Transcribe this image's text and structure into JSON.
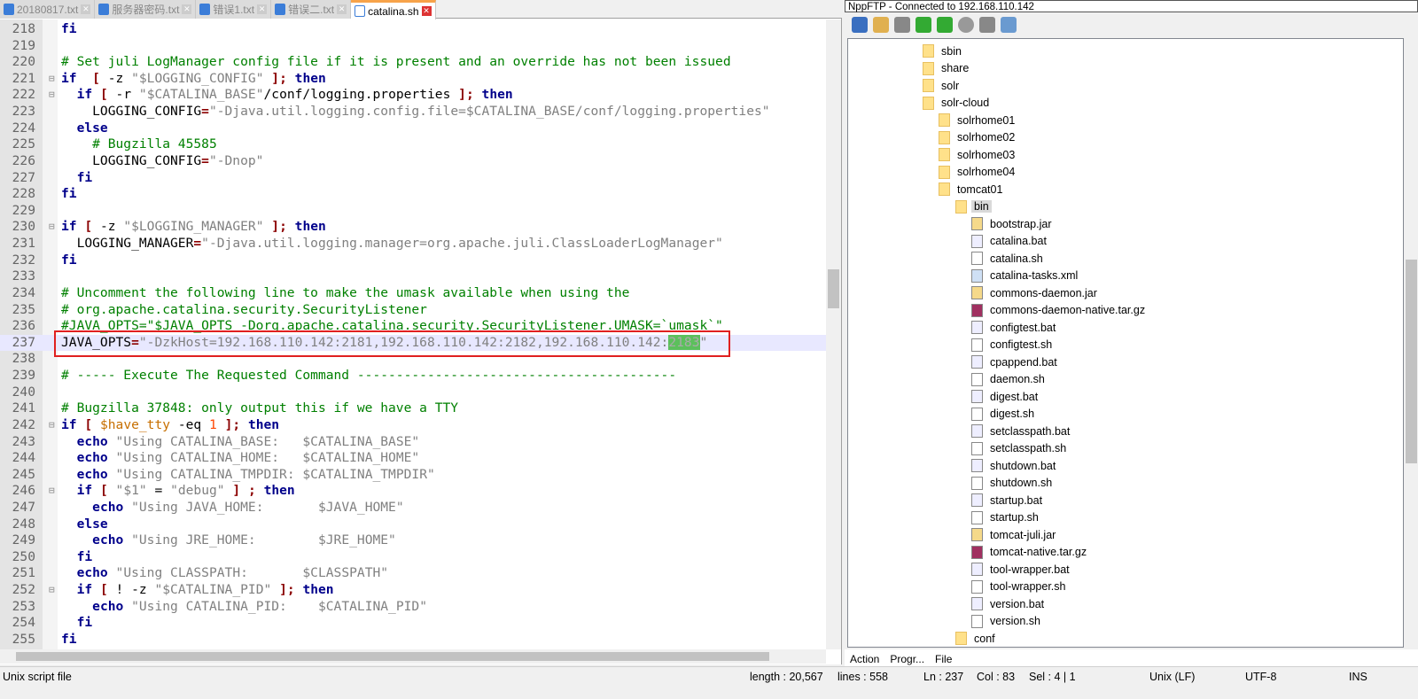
{
  "tabs": [
    {
      "label": "20180817.txt",
      "active": false
    },
    {
      "label": "服务器密码.txt",
      "active": false
    },
    {
      "label": "错误1.txt",
      "active": false
    },
    {
      "label": "错误二.txt",
      "active": false
    },
    {
      "label": "catalina.sh",
      "active": true
    }
  ],
  "editor": {
    "current_line": 237,
    "lines": [
      {
        "n": 218,
        "t": [
          [
            "kw",
            "fi"
          ]
        ]
      },
      {
        "n": 219,
        "t": []
      },
      {
        "n": 220,
        "t": [
          [
            "cm",
            "# Set juli LogManager config file if it is present and an override has not been issued"
          ]
        ]
      },
      {
        "n": 221,
        "t": [
          [
            "kw",
            "if"
          ],
          [
            "",
            "  "
          ],
          [
            "op",
            "["
          ],
          [
            "",
            " -z "
          ],
          [
            "str",
            "\"$LOGGING_CONFIG\""
          ],
          [
            "",
            " "
          ],
          [
            "op",
            "];"
          ],
          [
            "",
            " "
          ],
          [
            "kw",
            "then"
          ]
        ]
      },
      {
        "n": 222,
        "t": [
          [
            "",
            "  "
          ],
          [
            "kw",
            "if"
          ],
          [
            "",
            " "
          ],
          [
            "op",
            "["
          ],
          [
            "",
            " -r "
          ],
          [
            "str",
            "\"$CATALINA_BASE\""
          ],
          [
            "",
            "/conf/logging.properties "
          ],
          [
            "op",
            "];"
          ],
          [
            "",
            " "
          ],
          [
            "kw",
            "then"
          ]
        ]
      },
      {
        "n": 223,
        "t": [
          [
            "",
            "    LOGGING_CONFIG"
          ],
          [
            "op",
            "="
          ],
          [
            "str",
            "\"-Djava.util.logging.config.file=$CATALINA_BASE/conf/logging.properties\""
          ]
        ]
      },
      {
        "n": 224,
        "t": [
          [
            "",
            "  "
          ],
          [
            "kw",
            "else"
          ]
        ]
      },
      {
        "n": 225,
        "t": [
          [
            "",
            "    "
          ],
          [
            "cm",
            "# Bugzilla 45585"
          ]
        ]
      },
      {
        "n": 226,
        "t": [
          [
            "",
            "    LOGGING_CONFIG"
          ],
          [
            "op",
            "="
          ],
          [
            "str",
            "\"-Dnop\""
          ]
        ]
      },
      {
        "n": 227,
        "t": [
          [
            "",
            "  "
          ],
          [
            "kw",
            "fi"
          ]
        ]
      },
      {
        "n": 228,
        "t": [
          [
            "kw",
            "fi"
          ]
        ]
      },
      {
        "n": 229,
        "t": []
      },
      {
        "n": 230,
        "t": [
          [
            "kw",
            "if"
          ],
          [
            "",
            " "
          ],
          [
            "op",
            "["
          ],
          [
            "",
            " -z "
          ],
          [
            "str",
            "\"$LOGGING_MANAGER\""
          ],
          [
            "",
            " "
          ],
          [
            "op",
            "];"
          ],
          [
            "",
            " "
          ],
          [
            "kw",
            "then"
          ]
        ]
      },
      {
        "n": 231,
        "t": [
          [
            "",
            "  LOGGING_MANAGER"
          ],
          [
            "op",
            "="
          ],
          [
            "str",
            "\"-Djava.util.logging.manager=org.apache.juli.ClassLoaderLogManager\""
          ]
        ]
      },
      {
        "n": 232,
        "t": [
          [
            "kw",
            "fi"
          ]
        ]
      },
      {
        "n": 233,
        "t": []
      },
      {
        "n": 234,
        "t": [
          [
            "cm",
            "# Uncomment the following line to make the umask available when using the"
          ]
        ]
      },
      {
        "n": 235,
        "t": [
          [
            "cm",
            "# org.apache.catalina.security.SecurityListener"
          ]
        ]
      },
      {
        "n": 236,
        "t": [
          [
            "cm",
            "#JAVA_OPTS=\"$JAVA_OPTS -Dorg.apache.catalina.security.SecurityListener.UMASK=`umask`\""
          ]
        ]
      },
      {
        "n": 237,
        "t": [
          [
            "",
            "JAVA_OPTS"
          ],
          [
            "op",
            "="
          ],
          [
            "str",
            "\"-DzkHost=192.168.110.142:2181,192.168.110.142:2182,192.168.110.142:"
          ],
          [
            "sel",
            "2183"
          ],
          [
            "str",
            "\""
          ]
        ]
      },
      {
        "n": 238,
        "t": []
      },
      {
        "n": 239,
        "t": [
          [
            "cm",
            "# ----- Execute The Requested Command -----------------------------------------"
          ]
        ]
      },
      {
        "n": 240,
        "t": []
      },
      {
        "n": 241,
        "t": [
          [
            "cm",
            "# Bugzilla 37848: only output this if we have a TTY"
          ]
        ]
      },
      {
        "n": 242,
        "t": [
          [
            "kw",
            "if"
          ],
          [
            "",
            " "
          ],
          [
            "op",
            "["
          ],
          [
            "",
            " "
          ],
          [
            "var",
            "$have_tty"
          ],
          [
            "",
            " -eq "
          ],
          [
            "num",
            "1"
          ],
          [
            "",
            " "
          ],
          [
            "op",
            "];"
          ],
          [
            "",
            " "
          ],
          [
            "kw",
            "then"
          ]
        ]
      },
      {
        "n": 243,
        "t": [
          [
            "",
            "  "
          ],
          [
            "kw",
            "echo"
          ],
          [
            "",
            " "
          ],
          [
            "str",
            "\"Using CATALINA_BASE:   $CATALINA_BASE\""
          ]
        ]
      },
      {
        "n": 244,
        "t": [
          [
            "",
            "  "
          ],
          [
            "kw",
            "echo"
          ],
          [
            "",
            " "
          ],
          [
            "str",
            "\"Using CATALINA_HOME:   $CATALINA_HOME\""
          ]
        ]
      },
      {
        "n": 245,
        "t": [
          [
            "",
            "  "
          ],
          [
            "kw",
            "echo"
          ],
          [
            "",
            " "
          ],
          [
            "str",
            "\"Using CATALINA_TMPDIR: $CATALINA_TMPDIR\""
          ]
        ]
      },
      {
        "n": 246,
        "t": [
          [
            "",
            "  "
          ],
          [
            "kw",
            "if"
          ],
          [
            "",
            " "
          ],
          [
            "op",
            "["
          ],
          [
            "",
            " "
          ],
          [
            "str",
            "\"$1\""
          ],
          [
            "",
            " = "
          ],
          [
            "str",
            "\"debug\""
          ],
          [
            "",
            " "
          ],
          [
            "op",
            "]"
          ],
          [
            "",
            " "
          ],
          [
            "op",
            ";"
          ],
          [
            "",
            " "
          ],
          [
            "kw",
            "then"
          ]
        ]
      },
      {
        "n": 247,
        "t": [
          [
            "",
            "    "
          ],
          [
            "kw",
            "echo"
          ],
          [
            "",
            " "
          ],
          [
            "str",
            "\"Using JAVA_HOME:       $JAVA_HOME\""
          ]
        ]
      },
      {
        "n": 248,
        "t": [
          [
            "",
            "  "
          ],
          [
            "kw",
            "else"
          ]
        ]
      },
      {
        "n": 249,
        "t": [
          [
            "",
            "    "
          ],
          [
            "kw",
            "echo"
          ],
          [
            "",
            " "
          ],
          [
            "str",
            "\"Using JRE_HOME:        $JRE_HOME\""
          ]
        ]
      },
      {
        "n": 250,
        "t": [
          [
            "",
            "  "
          ],
          [
            "kw",
            "fi"
          ]
        ]
      },
      {
        "n": 251,
        "t": [
          [
            "",
            "  "
          ],
          [
            "kw",
            "echo"
          ],
          [
            "",
            " "
          ],
          [
            "str",
            "\"Using CLASSPATH:       $CLASSPATH\""
          ]
        ]
      },
      {
        "n": 252,
        "t": [
          [
            "",
            "  "
          ],
          [
            "kw",
            "if"
          ],
          [
            "",
            " "
          ],
          [
            "op",
            "["
          ],
          [
            "",
            " ! -z "
          ],
          [
            "str",
            "\"$CATALINA_PID\""
          ],
          [
            "",
            " "
          ],
          [
            "op",
            "];"
          ],
          [
            "",
            " "
          ],
          [
            "kw",
            "then"
          ]
        ]
      },
      {
        "n": 253,
        "t": [
          [
            "",
            "    "
          ],
          [
            "kw",
            "echo"
          ],
          [
            "",
            " "
          ],
          [
            "str",
            "\"Using CATALINA_PID:    $CATALINA_PID\""
          ]
        ]
      },
      {
        "n": 254,
        "t": [
          [
            "",
            "  "
          ],
          [
            "kw",
            "fi"
          ]
        ]
      },
      {
        "n": 255,
        "t": [
          [
            "kw",
            "fi"
          ]
        ]
      }
    ]
  },
  "ftp": {
    "title": "NppFTP - Connected to 192.168.110.142",
    "toolbar": [
      "connect-icon",
      "open-folder-icon",
      "download-icon",
      "upload-icon",
      "refresh-icon",
      "abort-icon",
      "settings-icon",
      "message-window-icon"
    ],
    "tree": [
      {
        "label": "sbin",
        "level": 0,
        "type": "folder"
      },
      {
        "label": "share",
        "level": 0,
        "type": "folder"
      },
      {
        "label": "solr",
        "level": 0,
        "type": "folder"
      },
      {
        "label": "solr-cloud",
        "level": 0,
        "type": "folder"
      },
      {
        "label": "solrhome01",
        "level": 1,
        "type": "folder"
      },
      {
        "label": "solrhome02",
        "level": 1,
        "type": "folder"
      },
      {
        "label": "solrhome03",
        "level": 1,
        "type": "folder"
      },
      {
        "label": "solrhome04",
        "level": 1,
        "type": "folder"
      },
      {
        "label": "tomcat01",
        "level": 1,
        "type": "folder"
      },
      {
        "label": "bin",
        "level": 2,
        "type": "folder",
        "selected": true
      },
      {
        "label": "bootstrap.jar",
        "level": 3,
        "type": "jar"
      },
      {
        "label": "catalina.bat",
        "level": 3,
        "type": "bat"
      },
      {
        "label": "catalina.sh",
        "level": 3,
        "type": "file"
      },
      {
        "label": "catalina-tasks.xml",
        "level": 3,
        "type": "xml"
      },
      {
        "label": "commons-daemon.jar",
        "level": 3,
        "type": "jar"
      },
      {
        "label": "commons-daemon-native.tar.gz",
        "level": 3,
        "type": "gz"
      },
      {
        "label": "configtest.bat",
        "level": 3,
        "type": "bat"
      },
      {
        "label": "configtest.sh",
        "level": 3,
        "type": "file"
      },
      {
        "label": "cpappend.bat",
        "level": 3,
        "type": "bat"
      },
      {
        "label": "daemon.sh",
        "level": 3,
        "type": "file"
      },
      {
        "label": "digest.bat",
        "level": 3,
        "type": "bat"
      },
      {
        "label": "digest.sh",
        "level": 3,
        "type": "file"
      },
      {
        "label": "setclasspath.bat",
        "level": 3,
        "type": "bat"
      },
      {
        "label": "setclasspath.sh",
        "level": 3,
        "type": "file"
      },
      {
        "label": "shutdown.bat",
        "level": 3,
        "type": "bat"
      },
      {
        "label": "shutdown.sh",
        "level": 3,
        "type": "file"
      },
      {
        "label": "startup.bat",
        "level": 3,
        "type": "bat"
      },
      {
        "label": "startup.sh",
        "level": 3,
        "type": "file"
      },
      {
        "label": "tomcat-juli.jar",
        "level": 3,
        "type": "jar"
      },
      {
        "label": "tomcat-native.tar.gz",
        "level": 3,
        "type": "gz"
      },
      {
        "label": "tool-wrapper.bat",
        "level": 3,
        "type": "bat"
      },
      {
        "label": "tool-wrapper.sh",
        "level": 3,
        "type": "file"
      },
      {
        "label": "version.bat",
        "level": 3,
        "type": "bat"
      },
      {
        "label": "version.sh",
        "level": 3,
        "type": "file"
      },
      {
        "label": "conf",
        "level": 2,
        "type": "folder"
      }
    ],
    "tabs": [
      "Action",
      "Progr...",
      "File"
    ]
  },
  "status": {
    "file_type": "Unix script file",
    "length": "length : 20,567",
    "lines": "lines : 558",
    "ln": "Ln : 237",
    "col": "Col : 83",
    "sel": "Sel : 4 | 1",
    "eol": "Unix (LF)",
    "encoding": "UTF-8",
    "mode": "INS"
  }
}
